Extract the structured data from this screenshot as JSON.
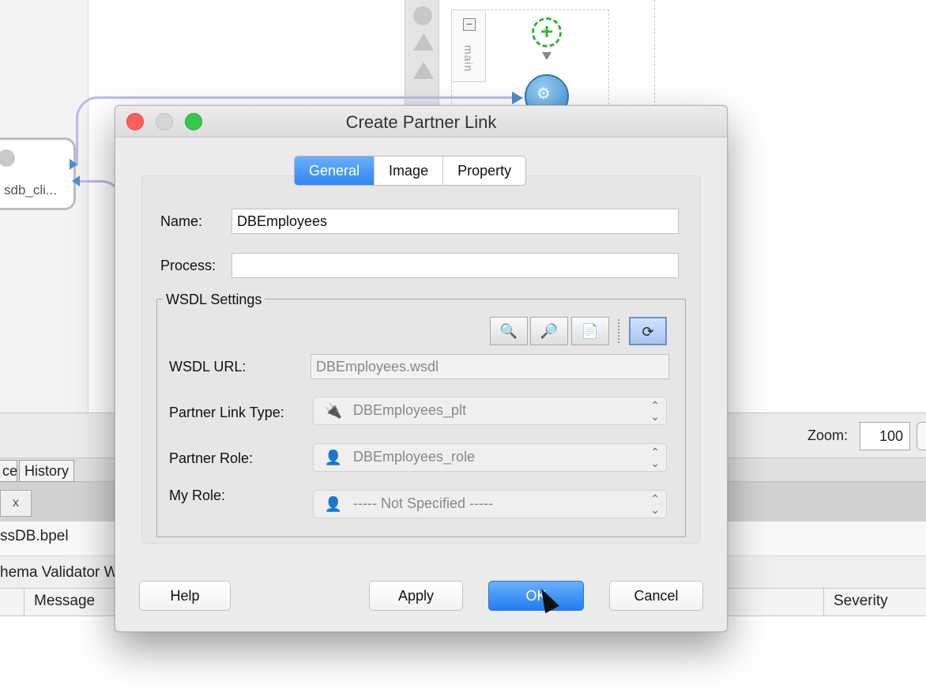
{
  "background": {
    "partner_node_label": "sdb_cli...",
    "scope_label": "main",
    "collapse_symbol": "−",
    "zoom_label": "Zoom:",
    "zoom_value": "100",
    "bottom_tabs": [
      "ce",
      "History"
    ],
    "close_symbol": "x",
    "file_name": "ssDB.bpel",
    "validator_tab": "hema Validator W",
    "table_columns": {
      "message": "Message",
      "severity": "Severity"
    }
  },
  "dialog": {
    "title": "Create Partner Link",
    "tabs": [
      {
        "label": "General",
        "active": true
      },
      {
        "label": "Image",
        "active": false
      },
      {
        "label": "Property",
        "active": false
      }
    ],
    "name_label": "Name:",
    "name_value": "DBEmployees",
    "process_label": "Process:",
    "process_value": "",
    "wsdl_group_label": "WSDL Settings",
    "toolbar_icons": [
      "search-icon",
      "browse-services-icon",
      "browse-files-icon",
      "refresh-icon"
    ],
    "wsdl_url_label": "WSDL URL:",
    "wsdl_url_value": "DBEmployees.wsdl",
    "partner_link_type_label": "Partner Link Type:",
    "partner_link_type_value": "DBEmployees_plt",
    "partner_role_label": "Partner Role:",
    "partner_role_value": "DBEmployees_role",
    "my_role_label": "My Role:",
    "my_role_value": "----- Not Specified -----",
    "buttons": {
      "help": "Help",
      "apply": "Apply",
      "ok": "OK",
      "cancel": "Cancel"
    }
  },
  "colors": {
    "accent_blue": "#2f86f1",
    "close_red": "#fc5f57",
    "zoom_green": "#35c94a",
    "add_green": "#2fb82f",
    "connection": "#b9bcf0"
  }
}
